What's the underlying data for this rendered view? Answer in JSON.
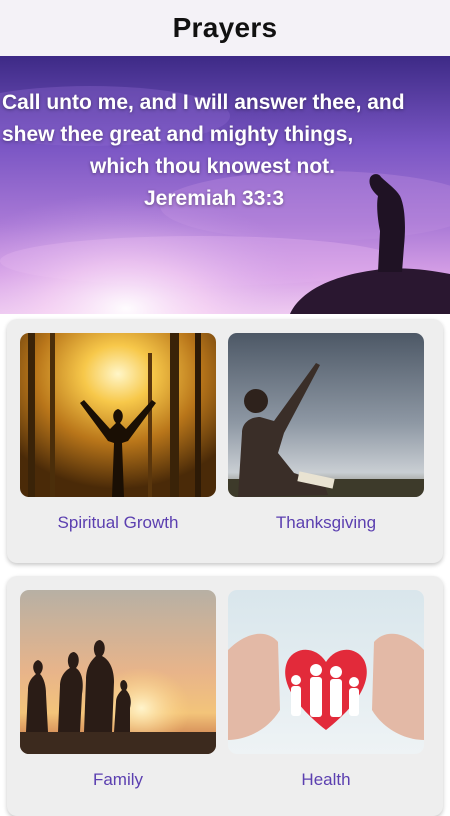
{
  "header": {
    "title": "Prayers"
  },
  "banner": {
    "verse_line1": "Call unto me, and I will answer thee, and",
    "verse_line2": "shew thee great and mighty things,",
    "verse_line3": "which thou knowest not.",
    "reference": "Jeremiah 33:3"
  },
  "categories": [
    {
      "label": "Spiritual Growth",
      "image": "man-raising-arms-in-sunlit-forest"
    },
    {
      "label": "Thanksgiving",
      "image": "man-reaching-to-sky-with-bible"
    },
    {
      "label": "Family",
      "image": "family-silhouette-at-sunset"
    },
    {
      "label": "Health",
      "image": "hands-protecting-heart-and-family"
    }
  ]
}
